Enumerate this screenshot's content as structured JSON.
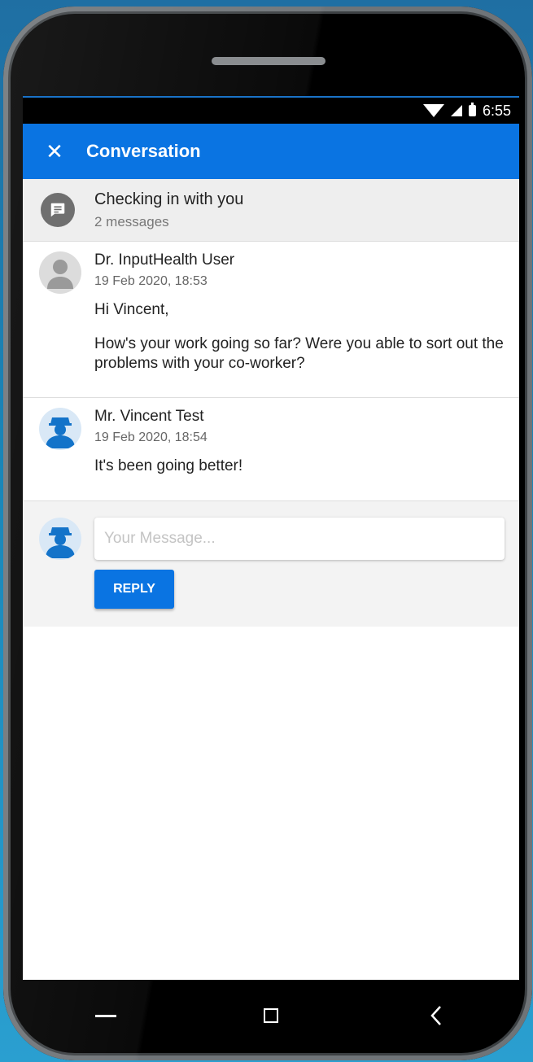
{
  "status_bar": {
    "time": "6:55"
  },
  "app_bar": {
    "close_icon": "close-icon",
    "title": "Conversation"
  },
  "thread": {
    "icon": "message-icon",
    "title": "Checking in with you",
    "subtitle": "2 messages"
  },
  "messages": [
    {
      "author": "Dr. InputHealth User",
      "date": "19 Feb 2020, 18:53",
      "avatar": "person-icon",
      "paragraphs": [
        "Hi Vincent,",
        "How's your work going so far? Were you able to sort out the problems with your co-worker?"
      ]
    },
    {
      "author": "Mr. Vincent Test",
      "date": "19 Feb 2020, 18:54",
      "avatar": "user-avatar-icon",
      "paragraphs": [
        "It's been going better!"
      ]
    }
  ],
  "reply": {
    "placeholder": "Your Message...",
    "button_label": "REPLY"
  },
  "colors": {
    "primary": "#0a74e2",
    "header_bg": "#eeeeee",
    "reply_bg": "#f3f3f3"
  }
}
